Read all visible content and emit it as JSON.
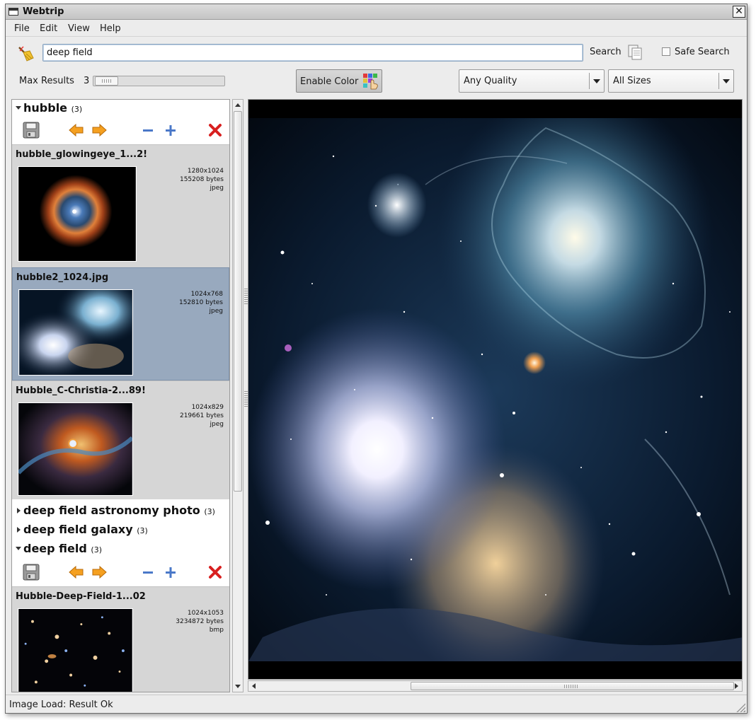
{
  "window": {
    "title": "Webtrip"
  },
  "menu": [
    "File",
    "Edit",
    "View",
    "Help"
  ],
  "search": {
    "query": "deep field",
    "button_label": "Search",
    "safe_search_label": "Safe Search",
    "safe_search_checked": false
  },
  "options": {
    "max_results_label": "Max Results",
    "max_results_value": "3",
    "enable_color_label": "Enable Color",
    "quality_selected": "Any Quality",
    "size_selected": "All Sizes"
  },
  "groups": [
    {
      "name": "hubble",
      "count": "(3)",
      "expanded": true,
      "results": [
        {
          "filename": "hubble_glowingeye_1...2!",
          "dimensions": "1280x1024",
          "size": "155208 bytes",
          "format": "jpeg",
          "selected": false
        },
        {
          "filename": "hubble2_1024.jpg",
          "dimensions": "1024x768",
          "size": "152810 bytes",
          "format": "jpeg",
          "selected": true
        },
        {
          "filename": "Hubble_C-Christia-2...89!",
          "dimensions": "1024x829",
          "size": "219661 bytes",
          "format": "jpeg",
          "selected": false
        }
      ]
    },
    {
      "name": "deep field astronomy photo",
      "count": "(3)",
      "expanded": false
    },
    {
      "name": "deep field galaxy",
      "count": "(3)",
      "expanded": false
    },
    {
      "name": "deep field",
      "count": "(3)",
      "expanded": true,
      "results": [
        {
          "filename": "Hubble-Deep-Field-1...02",
          "dimensions": "1024x1053",
          "size": "3234872 bytes",
          "format": "bmp",
          "selected": false
        }
      ]
    }
  ],
  "icons": {
    "toolbar": [
      "save-icon",
      "arrow-left-icon",
      "arrow-right-icon",
      "minus-icon",
      "plus-icon",
      "delete-icon"
    ],
    "clear": "broom-icon",
    "search": "document-copy-icon",
    "color": "palette-icon"
  },
  "status": {
    "text": "Image Load: Result Ok"
  }
}
